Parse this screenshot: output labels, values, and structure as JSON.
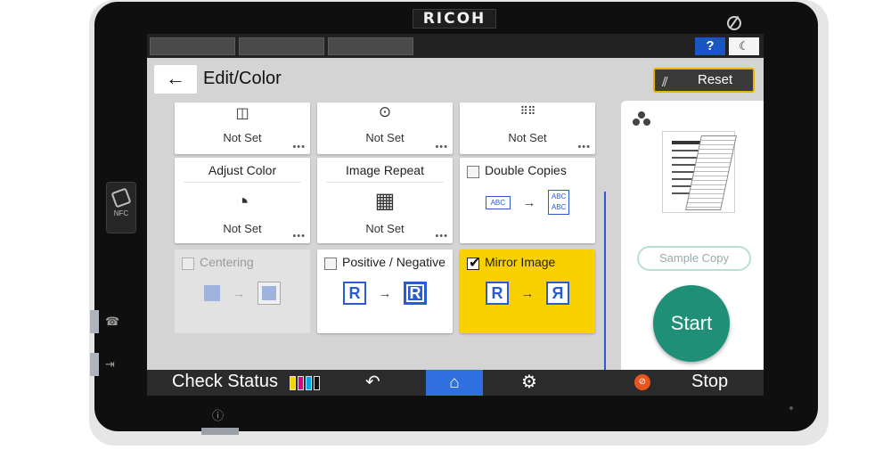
{
  "device": {
    "brand": "RICOH",
    "nfc_label": "NFC"
  },
  "status_bar": {
    "help_label": "?",
    "sleep_icon": "moon-icon"
  },
  "header": {
    "title": "Edit/Color",
    "back_icon": "back-arrow-icon",
    "reset_label": "Reset"
  },
  "tiles": {
    "row0": [
      {
        "status": "Not Set",
        "icon": "book-icon"
      },
      {
        "status": "Not Set",
        "icon": "erase-icon"
      },
      {
        "status": "Not Set",
        "icon": "dot-grid-icon"
      }
    ],
    "adjust_color": {
      "title": "Adjust Color",
      "status": "Not Set"
    },
    "image_repeat": {
      "title": "Image Repeat",
      "status": "Not Set"
    },
    "double_copies": {
      "title": "Double Copies",
      "checked": false,
      "sample_text": "ABC"
    },
    "centering": {
      "title": "Centering",
      "checked": false,
      "disabled": true
    },
    "positive_negative": {
      "title": "Positive / Negative",
      "checked": false,
      "glyph": "R"
    },
    "mirror_image": {
      "title": "Mirror Image",
      "checked": true,
      "glyph": "R",
      "mirrored_glyph": "Я"
    }
  },
  "right_panel": {
    "sample_copy_label": "Sample Copy",
    "start_label": "Start"
  },
  "bottom_bar": {
    "check_status_label": "Check Status",
    "stop_label": "Stop"
  },
  "colors": {
    "selected_tile": "#f9d000",
    "accent_blue": "#2a5bd0",
    "start_green": "#1f8f78",
    "reset_border": "#e8b400",
    "stop_orange": "#e7541e"
  }
}
